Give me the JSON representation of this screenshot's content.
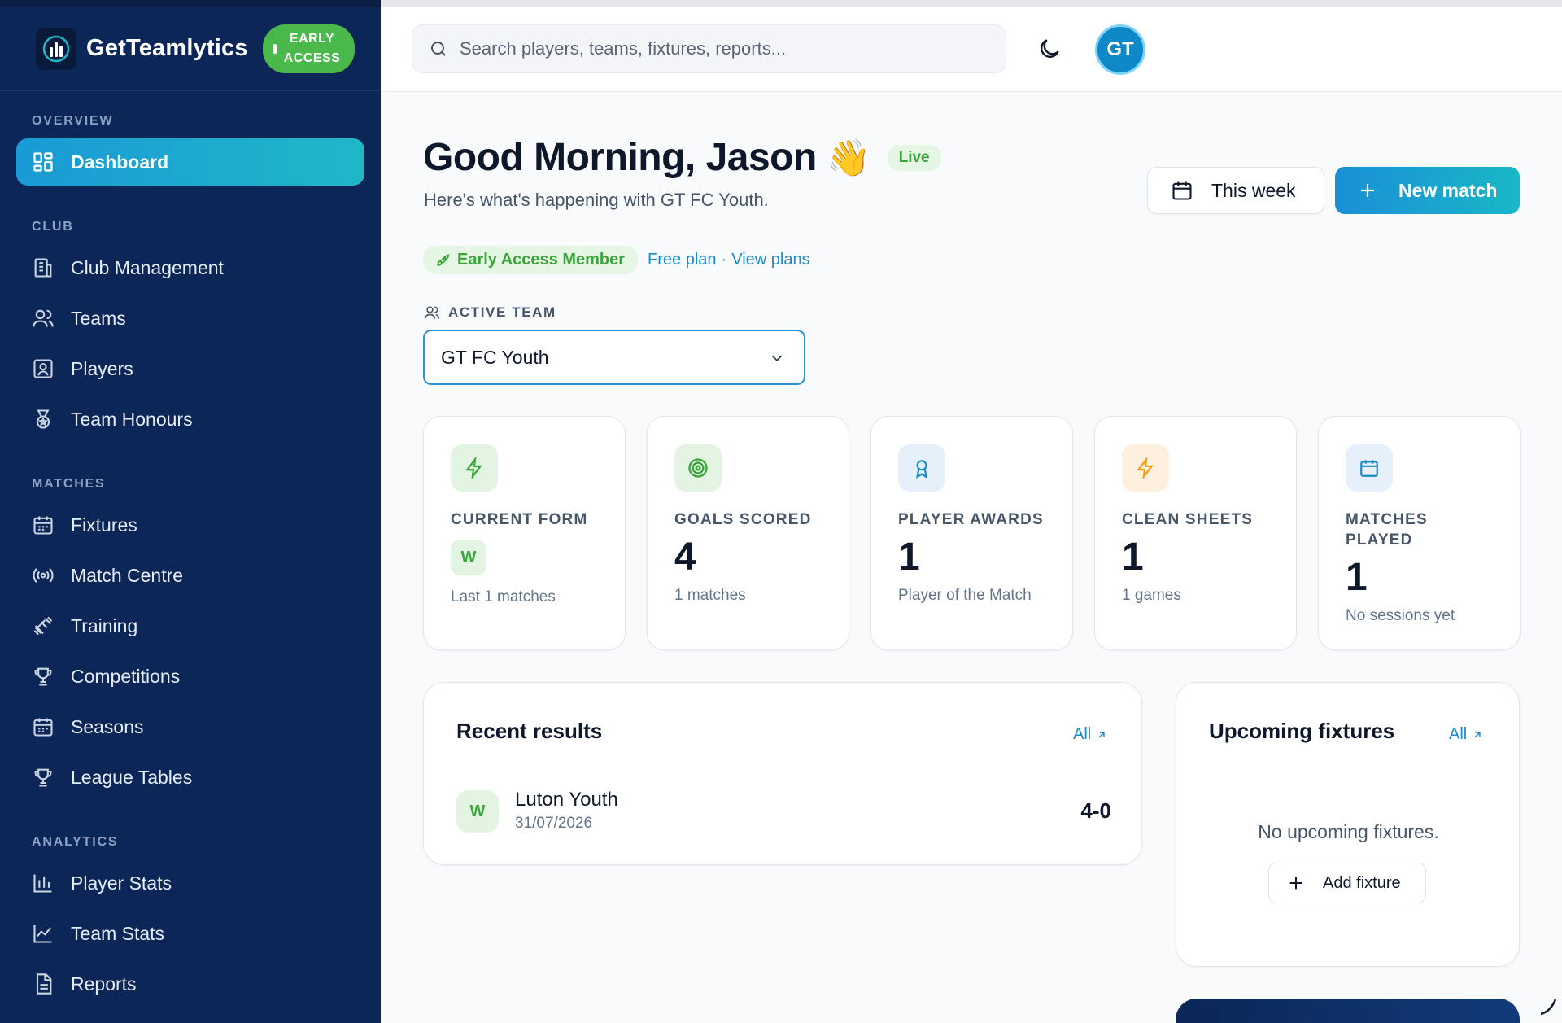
{
  "brand": {
    "name": "GetTeamlytics",
    "badge_line1": "EARLY",
    "badge_line2": "ACCESS"
  },
  "sidebar": {
    "sections": [
      {
        "title": "OVERVIEW",
        "items": [
          {
            "label": "Dashboard",
            "icon": "dashboard-icon",
            "active": true
          }
        ]
      },
      {
        "title": "CLUB",
        "items": [
          {
            "label": "Club Management",
            "icon": "building-icon"
          },
          {
            "label": "Teams",
            "icon": "users-icon"
          },
          {
            "label": "Players",
            "icon": "player-card-icon"
          },
          {
            "label": "Team Honours",
            "icon": "medal-icon"
          }
        ]
      },
      {
        "title": "MATCHES",
        "items": [
          {
            "label": "Fixtures",
            "icon": "calendar-icon"
          },
          {
            "label": "Match Centre",
            "icon": "broadcast-icon"
          },
          {
            "label": "Training",
            "icon": "dumbbell-icon"
          },
          {
            "label": "Competitions",
            "icon": "trophy-icon"
          },
          {
            "label": "Seasons",
            "icon": "calendar-icon"
          },
          {
            "label": "League Tables",
            "icon": "trophy-icon"
          }
        ]
      },
      {
        "title": "ANALYTICS",
        "items": [
          {
            "label": "Player Stats",
            "icon": "bar-chart-icon"
          },
          {
            "label": "Team Stats",
            "icon": "line-chart-icon"
          },
          {
            "label": "Reports",
            "icon": "document-icon"
          }
        ]
      }
    ]
  },
  "topbar": {
    "search_placeholder": "Search players, teams, fixtures, reports...",
    "avatar_initials": "GT"
  },
  "header": {
    "greeting": "Good Morning, Jason",
    "wave": "👋",
    "live_badge": "Live",
    "subtitle": "Here's what's happening with GT FC Youth.",
    "this_week_label": "This week",
    "new_match_label": "New match",
    "early_access_label": "Early Access Member",
    "free_plan_label": "Free plan",
    "separator": "·",
    "view_plans_label": "View plans"
  },
  "active_team": {
    "label": "ACTIVE TEAM",
    "value": "GT FC Youth"
  },
  "stats": {
    "current_form": {
      "label": "CURRENT FORM",
      "result": "W",
      "sub": "Last 1 matches"
    },
    "goals_scored": {
      "label": "GOALS SCORED",
      "value": "4",
      "sub": "1 matches"
    },
    "player_awards": {
      "label": "PLAYER AWARDS",
      "value": "1",
      "sub": "Player of the Match"
    },
    "clean_sheets": {
      "label": "CLEAN SHEETS",
      "value": "1",
      "sub": "1 games"
    },
    "matches_played": {
      "label_line1": "MATCHES",
      "label_line2": "PLAYED",
      "value": "1",
      "sub": "No sessions yet"
    }
  },
  "recent_results": {
    "title": "Recent results",
    "all_label": "All",
    "rows": [
      {
        "result": "W",
        "opponent": "Luton Youth",
        "date": "31/07/2026",
        "score": "4-0"
      }
    ]
  },
  "upcoming_fixtures": {
    "title": "Upcoming fixtures",
    "all_label": "All",
    "empty_message": "No upcoming fixtures.",
    "add_label": "Add fixture"
  },
  "colors": {
    "sidebar_bg": "#0b2657",
    "accent_start": "#1a8fd6",
    "accent_end": "#19b7c7",
    "success": "#3aa63a",
    "link": "#1a8bc7"
  }
}
